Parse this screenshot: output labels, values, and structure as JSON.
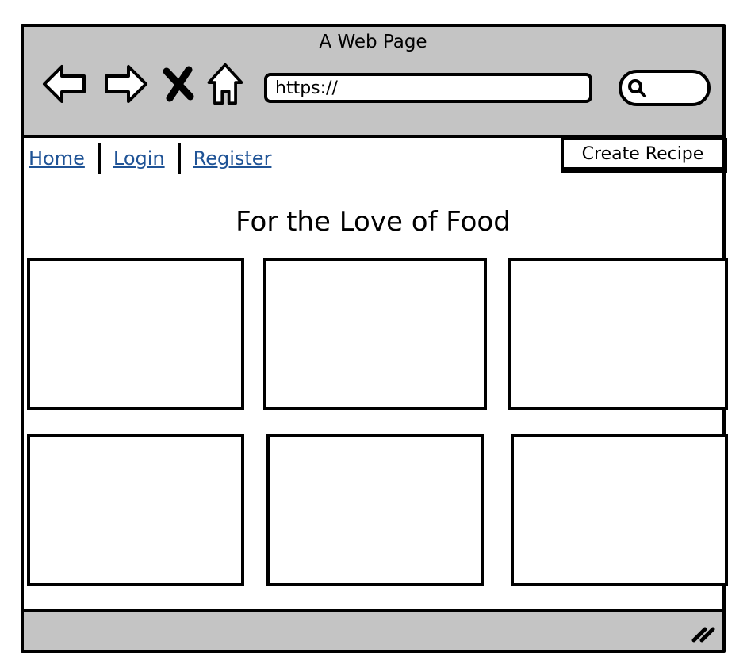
{
  "window": {
    "title": "A Web Page"
  },
  "toolbar": {
    "back_icon": "back-arrow-icon",
    "forward_icon": "forward-arrow-icon",
    "stop_icon": "close-x-icon",
    "home_icon": "home-icon"
  },
  "address": {
    "value": "https://"
  },
  "search": {
    "icon": "search-icon"
  },
  "nav": {
    "links": [
      "Home",
      "Login",
      "Register"
    ],
    "link_color": "#1f5396"
  },
  "actions": {
    "create_label": "Create Recipe"
  },
  "content": {
    "headline": "For the Love of Food",
    "cards": 6
  },
  "colors": {
    "chrome": "#c4c4c4",
    "link": "#1f5396"
  }
}
